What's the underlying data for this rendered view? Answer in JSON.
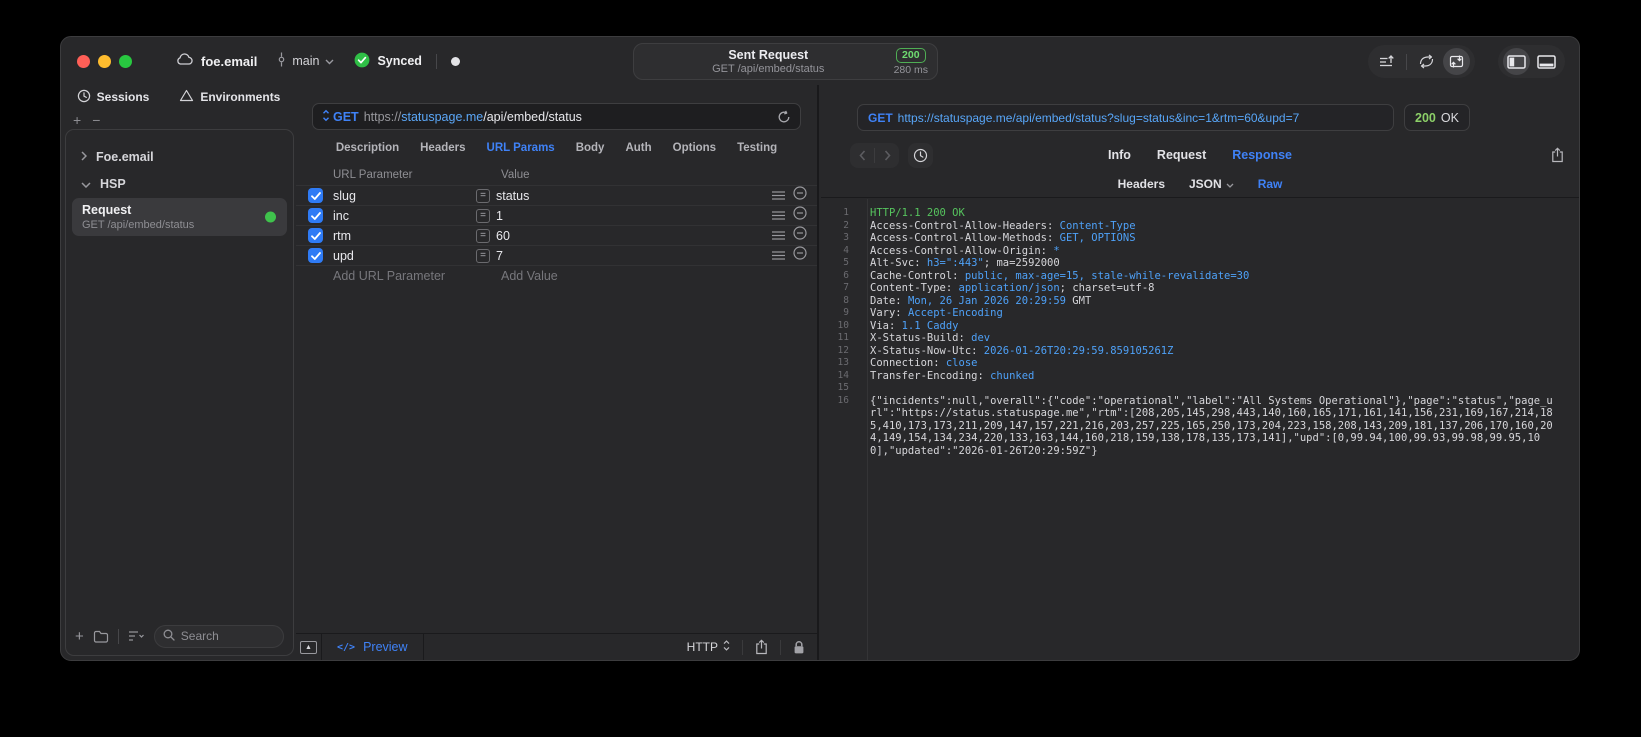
{
  "titlebar": {
    "project_name": "foe.email",
    "branch_name": "main",
    "sync_label": "Synced",
    "request_summary": {
      "title": "Sent Request",
      "subtitle": "GET /api/embed/status",
      "status_code": "200",
      "duration": "280 ms"
    }
  },
  "sidebar": {
    "tabs": [
      {
        "label": "Sessions"
      },
      {
        "label": "Environments"
      }
    ],
    "tree": [
      {
        "label": "Foe.email"
      },
      {
        "label": "HSP"
      }
    ],
    "request_item": {
      "title": "Request",
      "subtitle": "GET /api/embed/status"
    },
    "search_placeholder": "Search"
  },
  "request_panel": {
    "method": "GET",
    "url": {
      "scheme": "https://",
      "host": "statuspage.me",
      "path": "/api/embed/status"
    },
    "tabs": [
      "Description",
      "Headers",
      "URL Params",
      "Body",
      "Auth",
      "Options",
      "Testing"
    ],
    "active_tab": "URL Params",
    "table": {
      "headers": [
        "URL Parameter",
        "Value"
      ],
      "rows": [
        {
          "enabled": true,
          "name": "slug",
          "value": "status"
        },
        {
          "enabled": true,
          "name": "inc",
          "value": "1"
        },
        {
          "enabled": true,
          "name": "rtm",
          "value": "60"
        },
        {
          "enabled": true,
          "name": "upd",
          "value": "7"
        }
      ],
      "add_name_placeholder": "Add URL Parameter",
      "add_value_placeholder": "Add Value"
    },
    "footer": {
      "preview_label": "Preview",
      "protocol": "HTTP"
    }
  },
  "response_panel": {
    "method": "GET",
    "url": "https://statuspage.me/api/embed/status?slug=status&inc=1&rtm=60&upd=7",
    "status_code": "200",
    "status_text": "OK",
    "tabs": [
      "Info",
      "Request",
      "Response"
    ],
    "active_tab": "Response",
    "subtabs": [
      {
        "label": "Headers"
      },
      {
        "label": "JSON",
        "has_menu": true
      },
      {
        "label": "Raw"
      }
    ],
    "active_subtab": "Raw",
    "lines": [
      {
        "no": "1",
        "segs": [
          {
            "c": "g",
            "t": "HTTP/1.1 200 OK"
          }
        ]
      },
      {
        "no": "2",
        "segs": [
          {
            "c": "p",
            "t": "Access-Control-Allow-Headers: "
          },
          {
            "c": "v",
            "t": "Content-Type"
          }
        ]
      },
      {
        "no": "3",
        "segs": [
          {
            "c": "p",
            "t": "Access-Control-Allow-Methods: "
          },
          {
            "c": "v",
            "t": "GET, OPTIONS"
          }
        ]
      },
      {
        "no": "4",
        "segs": [
          {
            "c": "p",
            "t": "Access-Control-Allow-Origin: "
          },
          {
            "c": "v",
            "t": "*"
          }
        ]
      },
      {
        "no": "5",
        "segs": [
          {
            "c": "p",
            "t": "Alt-Svc: "
          },
          {
            "c": "v",
            "t": "h3=\":443\""
          },
          {
            "c": "p",
            "t": "; ma=2592000"
          }
        ]
      },
      {
        "no": "6",
        "segs": [
          {
            "c": "p",
            "t": "Cache-Control: "
          },
          {
            "c": "v",
            "t": "public, max-age=15, stale-while-revalidate=30"
          }
        ]
      },
      {
        "no": "7",
        "segs": [
          {
            "c": "p",
            "t": "Content-Type: "
          },
          {
            "c": "v",
            "t": "application/json"
          },
          {
            "c": "p",
            "t": "; charset=utf-8"
          }
        ]
      },
      {
        "no": "8",
        "segs": [
          {
            "c": "p",
            "t": "Date: "
          },
          {
            "c": "v",
            "t": "Mon, 26 Jan 2026 20:29:59"
          },
          {
            "c": "p",
            "t": " GMT"
          }
        ]
      },
      {
        "no": "9",
        "segs": [
          {
            "c": "p",
            "t": "Vary: "
          },
          {
            "c": "v",
            "t": "Accept-Encoding"
          }
        ]
      },
      {
        "no": "10",
        "segs": [
          {
            "c": "p",
            "t": "Via: "
          },
          {
            "c": "v",
            "t": "1.1 Caddy"
          }
        ]
      },
      {
        "no": "11",
        "segs": [
          {
            "c": "p",
            "t": "X-Status-Build: "
          },
          {
            "c": "v",
            "t": "dev"
          }
        ]
      },
      {
        "no": "12",
        "segs": [
          {
            "c": "p",
            "t": "X-Status-Now-Utc: "
          },
          {
            "c": "v",
            "t": "2026-01-26T20:29:59.859105261Z"
          }
        ]
      },
      {
        "no": "13",
        "segs": [
          {
            "c": "p",
            "t": "Connection: "
          },
          {
            "c": "v",
            "t": "close"
          }
        ]
      },
      {
        "no": "14",
        "segs": [
          {
            "c": "p",
            "t": "Transfer-Encoding: "
          },
          {
            "c": "v",
            "t": "chunked"
          }
        ]
      },
      {
        "no": "15",
        "segs": []
      },
      {
        "no": "16",
        "segs": [
          {
            "c": "p",
            "t": "{\"incidents\":null,\"overall\":{\"code\":\"operational\",\"label\":\"All Systems Operational\"},\"page\":\"status\",\"page_url\":\"https://status.statuspage.me\",\"rtm\":[208,205,145,298,443,140,160,165,171,161,141,156,231,169,167,214,185,410,173,173,211,209,147,157,221,216,203,257,225,165,250,173,204,223,158,208,143,209,181,137,206,170,160,204,149,154,134,234,220,133,163,144,160,218,159,138,178,135,173,141],\"upd\":[0,99.94,100,99.93,99.98,99.95,100],\"updated\":\"2026-01-26T20:29:59Z\"}"
          }
        ]
      }
    ]
  },
  "colors": {
    "accent_blue": "#3f82f7",
    "value_blue": "#4ea1f8",
    "green": "#3fc24c",
    "status_green": "#8ccf68"
  }
}
